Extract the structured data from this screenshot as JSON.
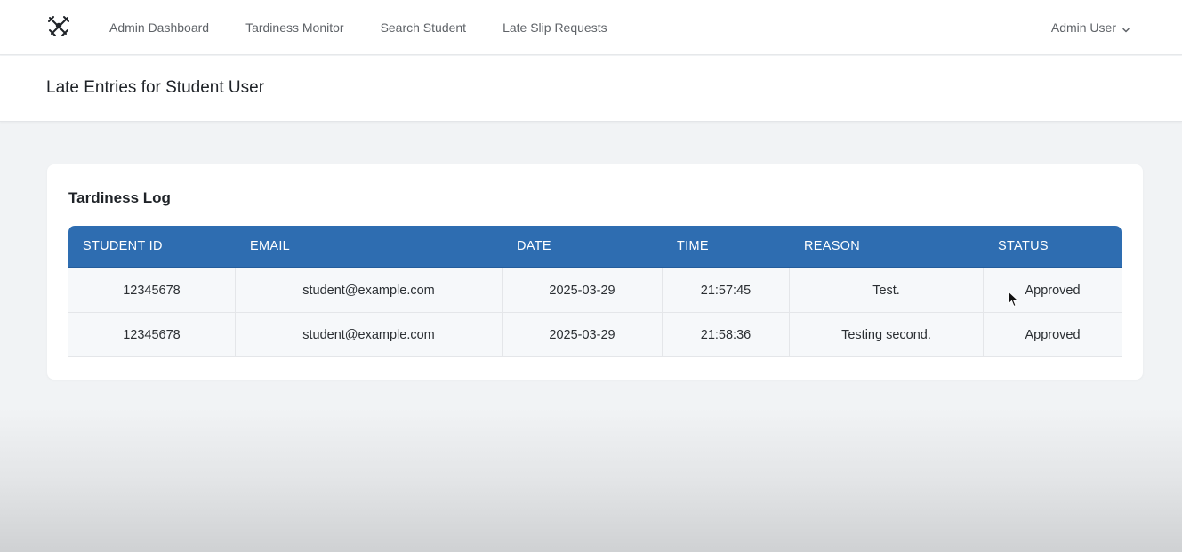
{
  "nav": {
    "logo_icon": "crossed-swords-logo-icon",
    "links": [
      {
        "label": "Admin Dashboard"
      },
      {
        "label": "Tardiness Monitor"
      },
      {
        "label": "Search Student"
      },
      {
        "label": "Late Slip Requests"
      }
    ],
    "user_label": "Admin User",
    "user_chevron_icon": "chevron-down-icon"
  },
  "header": {
    "title": "Late Entries for Student User"
  },
  "card": {
    "title": "Tardiness Log",
    "table": {
      "columns": [
        "STUDENT ID",
        "EMAIL",
        "DATE",
        "TIME",
        "REASON",
        "STATUS"
      ],
      "rows": [
        [
          "12345678",
          "student@example.com",
          "2025-03-29",
          "21:57:45",
          "Test.",
          "Approved"
        ],
        [
          "12345678",
          "student@example.com",
          "2025-03-29",
          "21:58:36",
          "Testing second.",
          "Approved"
        ]
      ]
    }
  },
  "colors": {
    "table_header": "#2e6db1",
    "page_background": "#f1f3f5",
    "text_primary": "#1f2328"
  }
}
